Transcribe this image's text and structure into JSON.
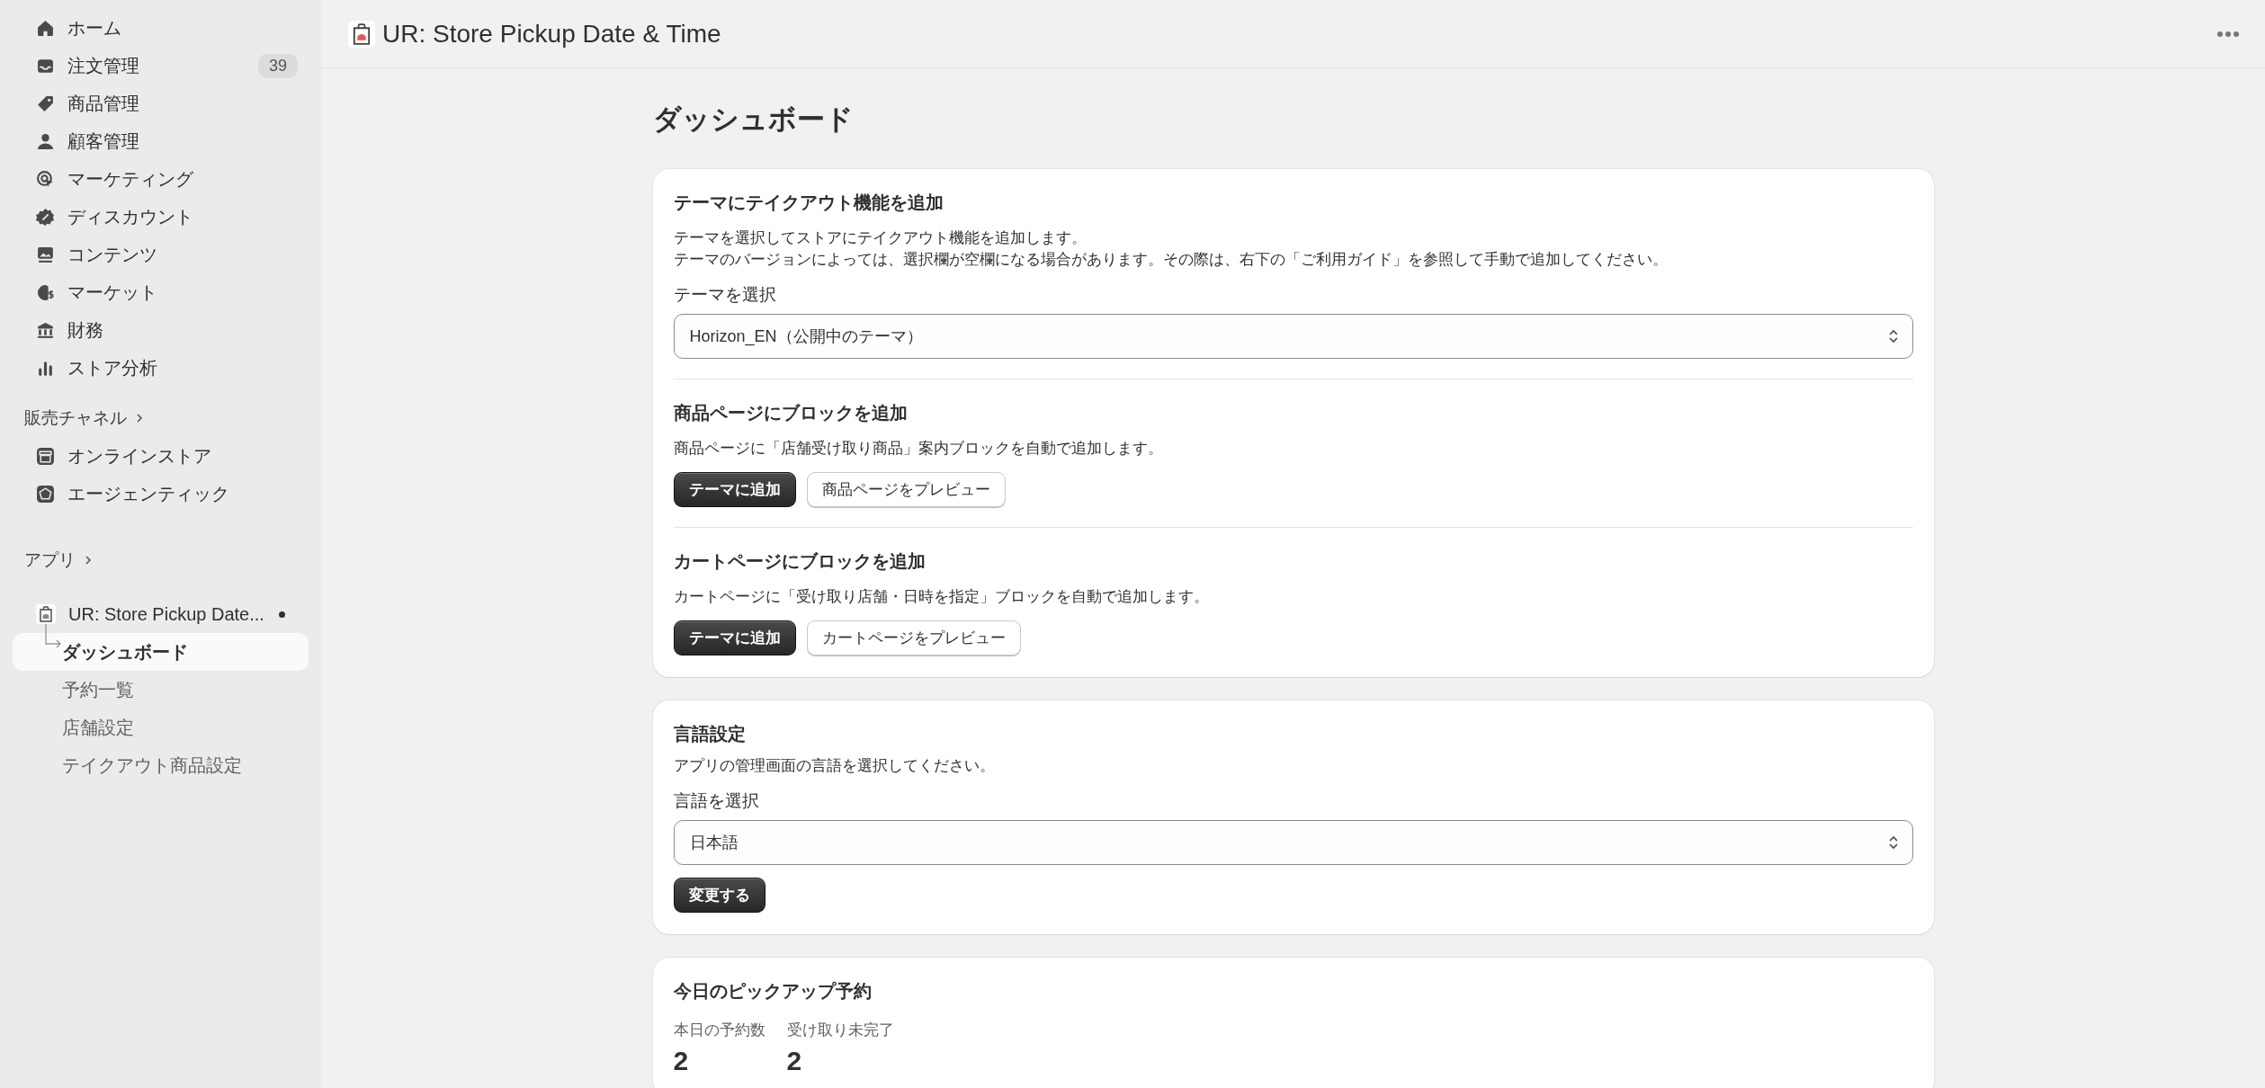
{
  "sidebar": {
    "nav_items": [
      {
        "label": "ホーム",
        "selected": false
      },
      {
        "label": "注文管理",
        "badge": "39",
        "selected": false
      },
      {
        "label": "商品管理",
        "selected": false
      },
      {
        "label": "顧客管理",
        "selected": false
      },
      {
        "label": "マーケティング",
        "selected": false
      },
      {
        "label": "ディスカウント",
        "selected": false
      },
      {
        "label": "コンテンツ",
        "selected": false
      },
      {
        "label": "マーケット",
        "selected": false
      },
      {
        "label": "財務",
        "selected": false
      },
      {
        "label": "ストア分析",
        "selected": false
      }
    ],
    "sales_channels": {
      "heading": "販売チャネル",
      "items": [
        {
          "label": "オンラインストア",
          "selected": false
        },
        {
          "label": "エージェンティック",
          "selected": false
        }
      ]
    },
    "apps": {
      "heading": "アプリ",
      "app": {
        "label": "UR: Store Pickup Date...",
        "notification": true
      },
      "sub_items": [
        {
          "label": "ダッシュボード",
          "selected": true
        },
        {
          "label": "予約一覧",
          "selected": false
        },
        {
          "label": "店舗設定",
          "selected": false
        },
        {
          "label": "テイクアウト商品設定",
          "selected": false
        }
      ]
    }
  },
  "header": {
    "title": "UR: Store Pickup Date & Time"
  },
  "page_title": "ダッシュボード",
  "theme_card": {
    "title": "テーマにテイクアウト機能を追加",
    "description": [
      "テーマを選択してストアにテイクアウト機能を追加します。",
      "テーマのバージョンによっては、選択欄が空欄になる場合があります。その際は、右下の「ご利用ガイド」を参照して手動で追加してください。"
    ],
    "field_label": "テーマを選択",
    "select_value": "Horizon_EN（公開中のテーマ）",
    "sections": [
      {
        "title": "商品ページにブロックを追加",
        "description": "商品ページに「店舗受け取り商品」案内ブロックを自動で追加します。",
        "buttons": [
          {
            "label": "テーマに追加",
            "kind": "primary"
          },
          {
            "label": "商品ページをプレビュー",
            "kind": "secondary"
          }
        ]
      },
      {
        "title": "カートページにブロックを追加",
        "description": "カートページに「受け取り店舗・日時を指定」ブロックを自動で追加します。",
        "buttons": [
          {
            "label": "テーマに追加",
            "kind": "primary"
          },
          {
            "label": "カートページをプレビュー",
            "kind": "secondary"
          }
        ]
      }
    ]
  },
  "language_card": {
    "title": "言語設定",
    "description": "アプリの管理画面の言語を選択してください。",
    "field_label": "言語を選択",
    "select_value": "日本語",
    "buttons": [
      {
        "label": "変更する",
        "kind": "primary"
      }
    ]
  },
  "pickup_card": {
    "title": "今日のピックアップ予約",
    "stats": [
      {
        "label": "本日の予約数",
        "value": "2"
      },
      {
        "label": "受け取り未完了",
        "value": "2"
      }
    ]
  }
}
